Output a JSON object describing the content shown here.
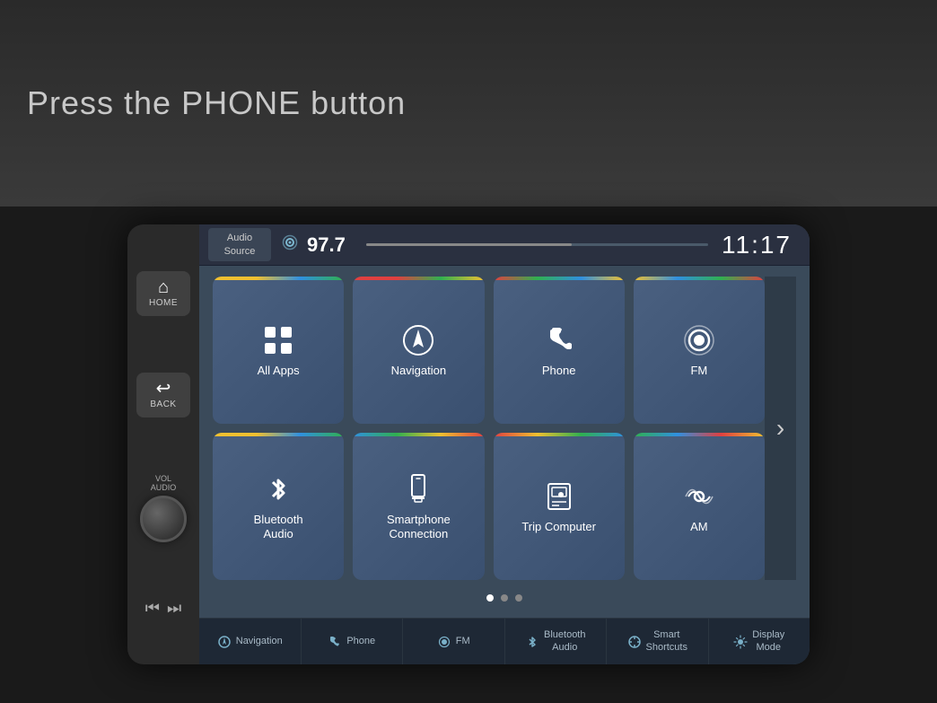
{
  "top_banner": {
    "text": "Press the PHONE button"
  },
  "header": {
    "audio_source": "Audio\nSource",
    "radio_icon": "📡",
    "station": "97.7",
    "time": "11:17"
  },
  "tiles": [
    {
      "id": "all-apps",
      "label": "All Apps",
      "icon": "grid",
      "class": "tile-all-apps"
    },
    {
      "id": "navigation",
      "label": "Navigation",
      "icon": "nav",
      "class": "tile-navigation"
    },
    {
      "id": "phone",
      "label": "Phone",
      "icon": "phone",
      "class": "tile-phone"
    },
    {
      "id": "fm",
      "label": "FM",
      "icon": "radio",
      "class": "tile-fm"
    },
    {
      "id": "bluetooth-audio",
      "label": "Bluetooth\nAudio",
      "icon": "bluetooth",
      "class": "tile-bluetooth"
    },
    {
      "id": "smartphone",
      "label": "Smartphone\nConnection",
      "icon": "smartphone",
      "class": "tile-smartphone"
    },
    {
      "id": "trip-computer",
      "label": "Trip Computer",
      "icon": "trip",
      "class": "tile-trip"
    },
    {
      "id": "am",
      "label": "AM",
      "icon": "radio-wave",
      "class": "tile-am"
    }
  ],
  "dots": [
    {
      "active": true
    },
    {
      "active": false
    },
    {
      "active": false
    }
  ],
  "bottom_nav": [
    {
      "id": "nav-navigation",
      "icon": "⊙",
      "label": "Navigation"
    },
    {
      "id": "nav-phone",
      "icon": "✆",
      "label": "Phone"
    },
    {
      "id": "nav-fm",
      "icon": "📻",
      "label": "FM"
    },
    {
      "id": "nav-bluetooth",
      "icon": "ᛒ",
      "label": "Bluetooth\nAudio"
    },
    {
      "id": "nav-smart-shortcuts",
      "icon": "✦",
      "label": "Smart\nShortcuts"
    },
    {
      "id": "nav-display-mode",
      "icon": "☼",
      "label": "Display\nMode"
    }
  ],
  "left_controls": {
    "home_label": "HOME",
    "back_label": "BACK",
    "vol_label": "VOL\nAUDIO"
  },
  "colors": {
    "accent_blue": "#3090e0",
    "accent_green": "#30b050",
    "accent_yellow": "#f0c030",
    "accent_red": "#e04040",
    "screen_bg": "#3a4a5a"
  }
}
